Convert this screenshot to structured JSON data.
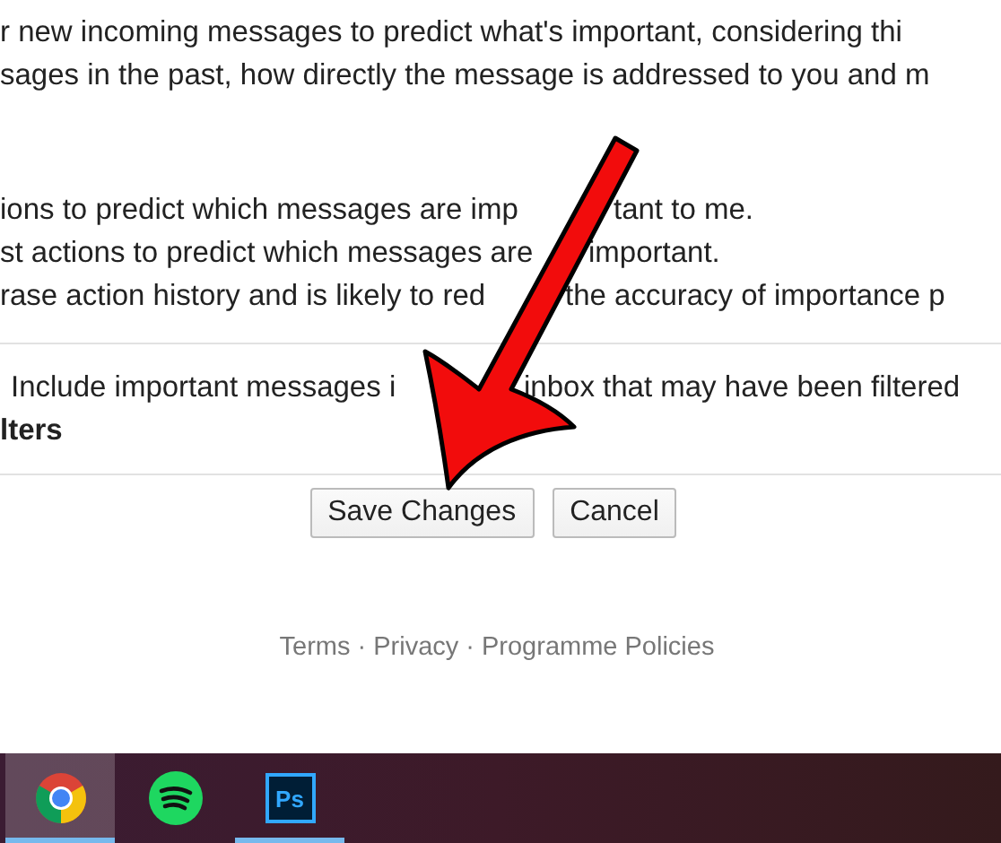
{
  "description_lines": [
    "r new incoming messages to predict what's important, considering thi",
    "sages in the past, how directly the message is addressed to you and m"
  ],
  "options": [
    {
      "segments": [
        "ions to predict which messages are imp",
        "tant to me."
      ]
    },
    {
      "segments": [
        "st actions to predict which messages are",
        "important."
      ]
    },
    {
      "segments": [
        "rase action history and is likely to red",
        "the accuracy of importance p"
      ]
    }
  ],
  "filter_option": {
    "segments": [
      "Include important messages i",
      "inbox that may have been filtered"
    ],
    "heading": "lters"
  },
  "buttons": [
    "Save Changes",
    "Cancel"
  ],
  "footer_links": [
    "Terms",
    "Privacy",
    "Programme Policies"
  ],
  "footer_separator": "·",
  "taskbar": [
    {
      "kind": "chrome",
      "selected": true,
      "running": true
    },
    {
      "kind": "spotify",
      "selected": false,
      "running": false
    },
    {
      "kind": "photoshop",
      "selected": false,
      "running": true,
      "label": "Ps"
    }
  ]
}
